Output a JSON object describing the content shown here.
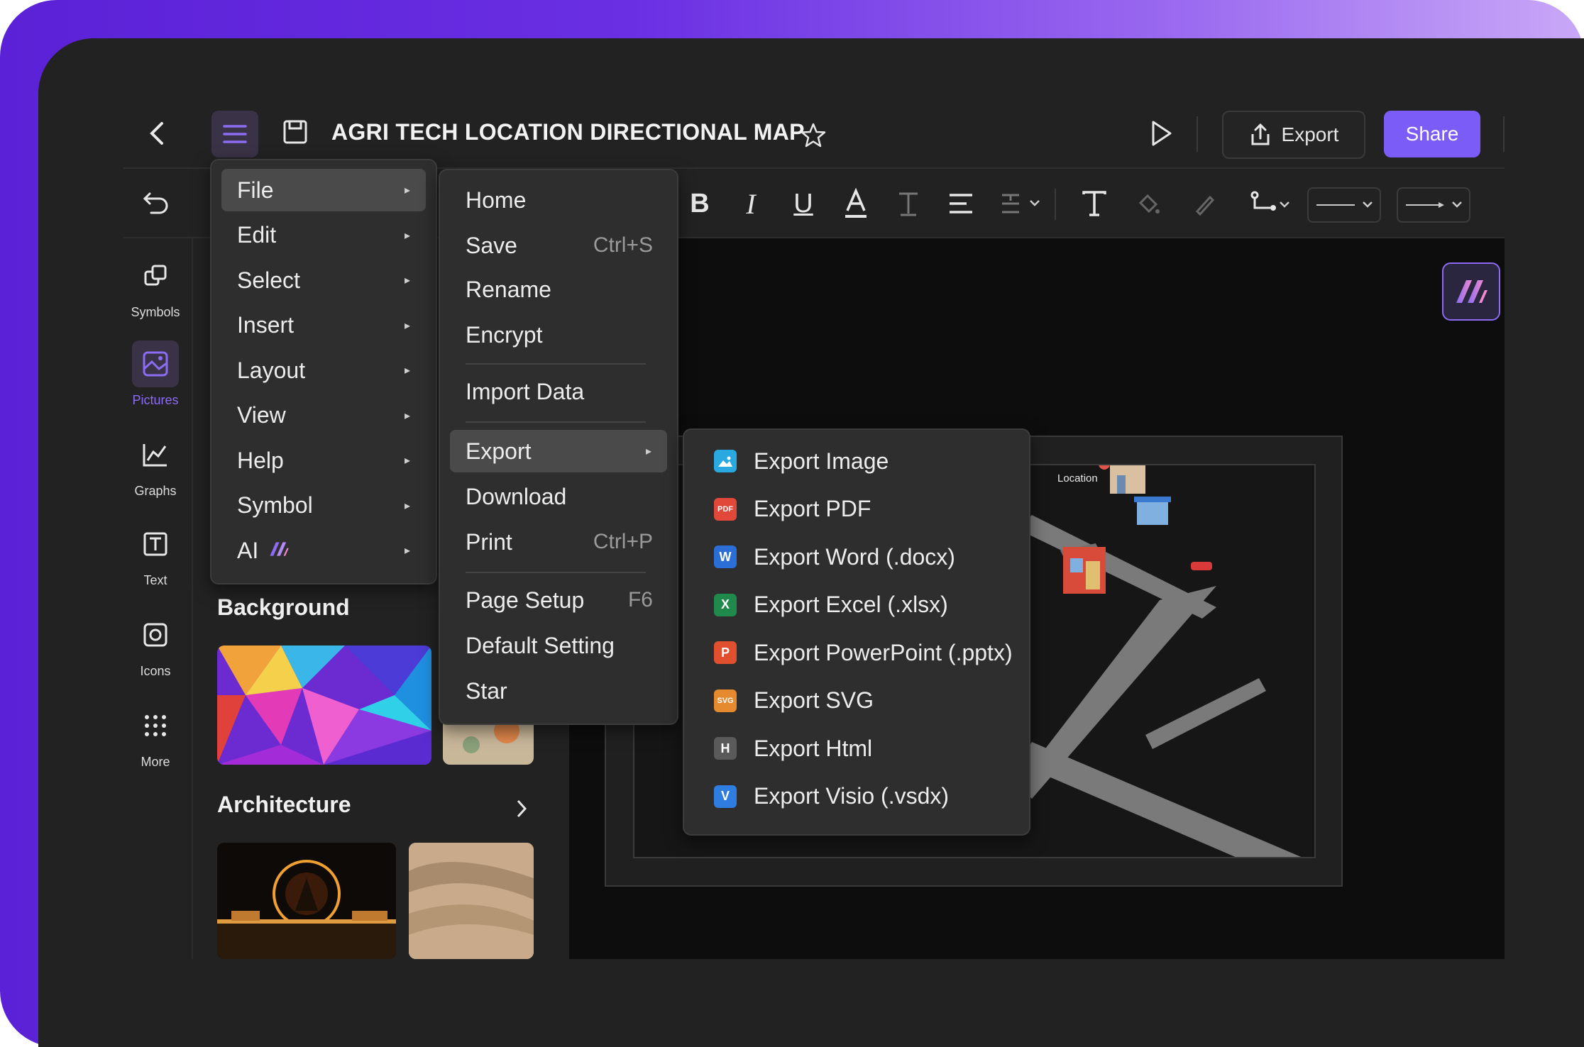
{
  "header": {
    "title": "AGRI TECH LOCATION DIRECTIONAL MAP",
    "export_label": "Export",
    "share_label": "Share"
  },
  "rail": [
    {
      "label": "Symbols",
      "icon": "symbols-icon"
    },
    {
      "label": "Pictures",
      "icon": "pictures-icon",
      "active": true
    },
    {
      "label": "Graphs",
      "icon": "graphs-icon"
    },
    {
      "label": "Text",
      "icon": "text-icon"
    },
    {
      "label": "Icons",
      "icon": "icons-icon"
    },
    {
      "label": "More",
      "icon": "more-icon"
    }
  ],
  "panel": {
    "background_title": "Background",
    "architecture_title": "Architecture"
  },
  "file_menu": [
    "File",
    "Edit",
    "Select",
    "Insert",
    "Layout",
    "View",
    "Help",
    "Symbol",
    "AI"
  ],
  "sub_menu": {
    "home": "Home",
    "save": "Save",
    "save_sc": "Ctrl+S",
    "rename": "Rename",
    "encrypt": "Encrypt",
    "import": "Import Data",
    "export": "Export",
    "download": "Download",
    "print": "Print",
    "print_sc": "Ctrl+P",
    "page_setup": "Page Setup",
    "page_setup_sc": "F6",
    "default_setting": "Default Setting",
    "star": "Star"
  },
  "export_menu": [
    {
      "label": "Export Image",
      "badge": "",
      "color": "#2aa8e0"
    },
    {
      "label": "Export PDF",
      "badge": "PDF",
      "color": "#e2483a"
    },
    {
      "label": "Export Word (.docx)",
      "badge": "W",
      "color": "#2b6fd6"
    },
    {
      "label": "Export Excel (.xlsx)",
      "badge": "X",
      "color": "#1f8a4c"
    },
    {
      "label": "Export PowerPoint (.pptx)",
      "badge": "P",
      "color": "#e0502f"
    },
    {
      "label": "Export SVG",
      "badge": "SVG",
      "color": "#e58a2e"
    },
    {
      "label": "Export Html",
      "badge": "H",
      "color": "#5a5a5a"
    },
    {
      "label": "Export Visio (.vsdx)",
      "badge": "V",
      "color": "#2f7de0"
    }
  ],
  "map": {
    "location_label": "Location"
  },
  "colors": {
    "accent": "#7b5cf6",
    "app_bg": "#222222",
    "canvas_bg": "#0d0d0d"
  }
}
